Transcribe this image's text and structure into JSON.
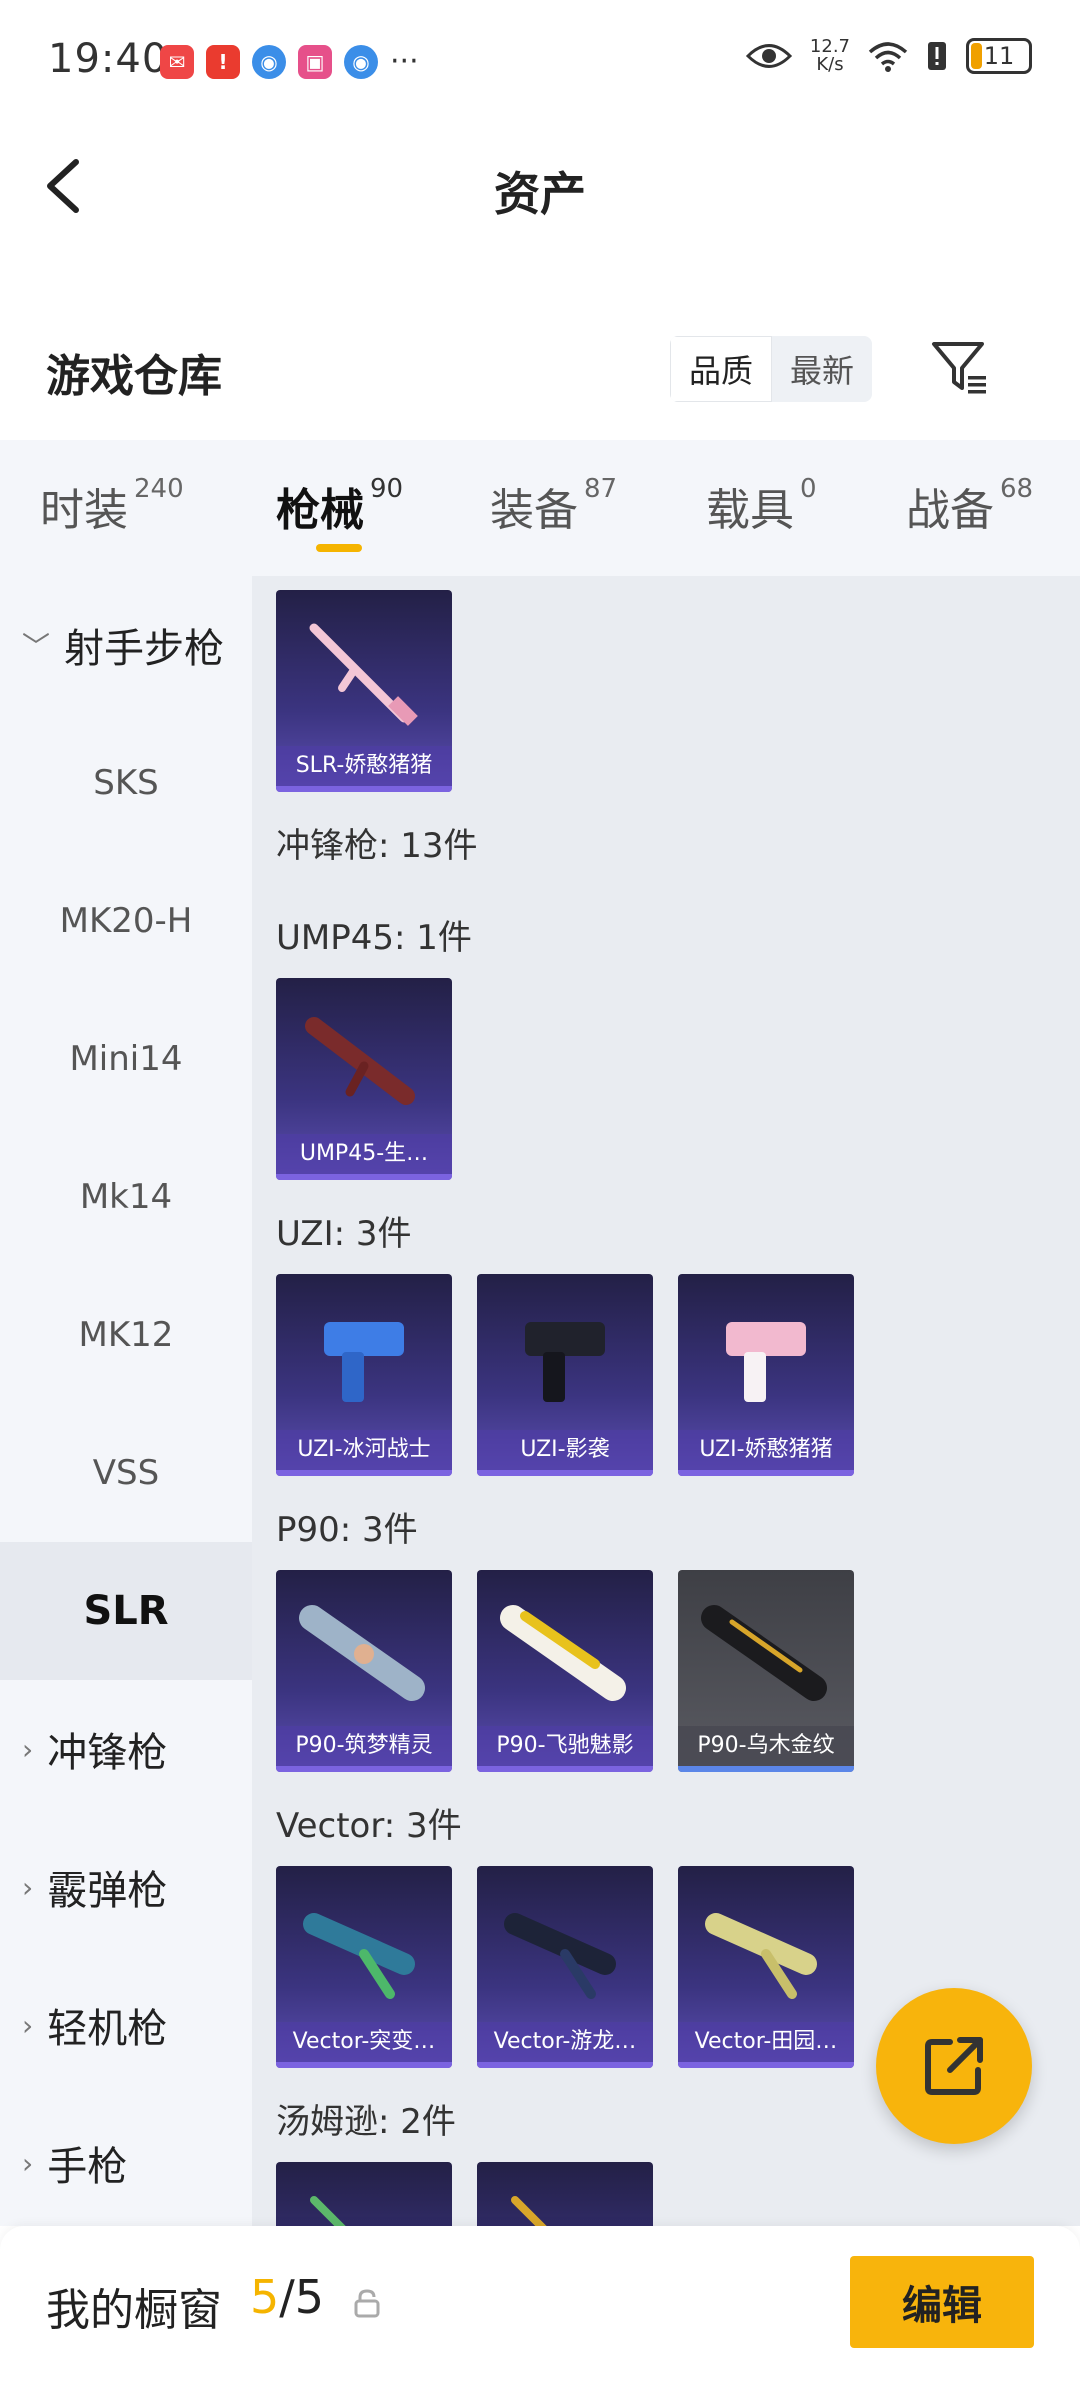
{
  "status_bar": {
    "time": "19:40",
    "net_speed_value": "12.7",
    "net_speed_unit": "K/s",
    "battery": "11"
  },
  "nav": {
    "title": "资产"
  },
  "section": {
    "title": "游戏仓库",
    "sort_options": [
      "品质",
      "最新"
    ],
    "active_sort": "品质"
  },
  "tabs": [
    {
      "label": "时装",
      "count": "240"
    },
    {
      "label": "枪械",
      "count": "90",
      "active": true
    },
    {
      "label": "装备",
      "count": "87"
    },
    {
      "label": "载具",
      "count": "0"
    },
    {
      "label": "战备",
      "count": "68"
    }
  ],
  "sidebar": {
    "items": [
      {
        "label": "射手步枪",
        "type": "category",
        "expanded": true
      },
      {
        "label": "SKS"
      },
      {
        "label": "MK20-H"
      },
      {
        "label": "Mini14"
      },
      {
        "label": "Mk14"
      },
      {
        "label": "MK12"
      },
      {
        "label": "VSS"
      },
      {
        "label": "SLR",
        "active": true
      },
      {
        "label": "冲锋枪",
        "type": "category"
      },
      {
        "label": "霰弹枪",
        "type": "category"
      },
      {
        "label": "轻机枪",
        "type": "category"
      },
      {
        "label": "手枪",
        "type": "category"
      }
    ]
  },
  "content": {
    "slr_items": [
      "SLR-娇憨猪猪"
    ],
    "smg_header": "冲锋枪: 13件",
    "groups": [
      {
        "label": "UMP45: 1件",
        "items": [
          "UMP45-生…"
        ]
      },
      {
        "label": "UZI: 3件",
        "items": [
          "UZI-冰河战士",
          "UZI-影袭",
          "UZI-娇憨猪猪"
        ]
      },
      {
        "label": "P90: 3件",
        "items": [
          "P90-筑梦精灵",
          "P90-飞驰魅影",
          "P90-乌木金纹"
        ]
      },
      {
        "label": "Vector: 3件",
        "items": [
          "Vector-突变…",
          "Vector-游龙…",
          "Vector-田园…"
        ]
      },
      {
        "label": "汤姆逊: 2件",
        "items": []
      }
    ]
  },
  "bottom_bar": {
    "label": "我的橱窗",
    "count_current": "5",
    "count_sep": "/",
    "count_total": "5",
    "edit_label": "编辑"
  },
  "colors": {
    "accent": "#f8b40c",
    "card_purple": "#3b3480"
  }
}
